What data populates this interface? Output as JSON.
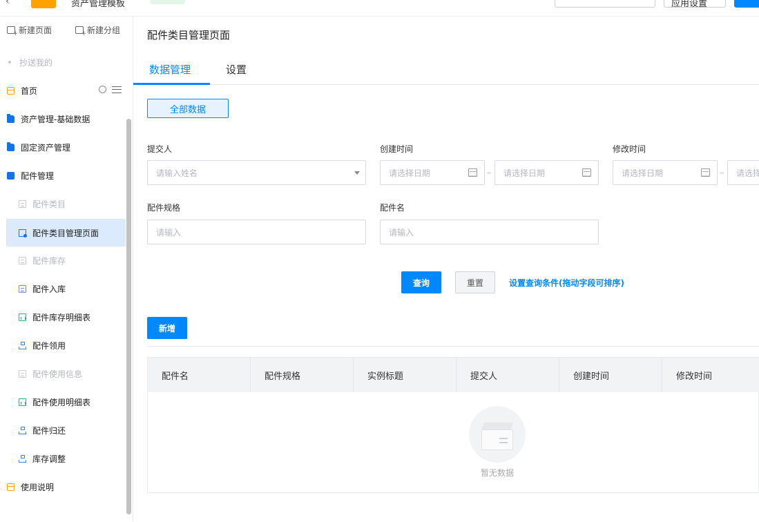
{
  "topbar": {
    "back_icon": "chevron-left-icon",
    "app_name": "资产管理模板",
    "mid_text": "",
    "button1": "",
    "button2": "应用设置",
    "button3": "",
    "accent": "#0089ff"
  },
  "sidebar": {
    "new_page": "新建页面",
    "new_group": "新建分组",
    "cc_me": "抄送我的",
    "home": "首页",
    "items": [
      {
        "label": "资产管理-基础数据",
        "icon": "folder-icon"
      },
      {
        "label": "固定资产管理",
        "icon": "folder-icon"
      },
      {
        "label": "配件管理",
        "icon": "folder-open-icon"
      }
    ],
    "children": [
      {
        "label": "配件类目",
        "icon": "form-icon",
        "state": "dim"
      },
      {
        "label": "配件类目管理页面",
        "icon": "admin-page-icon",
        "state": "active"
      },
      {
        "label": "配件库存",
        "icon": "form-icon",
        "state": "dim"
      },
      {
        "label": "配件入库",
        "icon": "form-icon",
        "state": "normal"
      },
      {
        "label": "配件库存明细表",
        "icon": "report-icon",
        "state": "normal"
      },
      {
        "label": "配件领用",
        "icon": "flow-icon",
        "state": "normal"
      },
      {
        "label": "配件使用信息",
        "icon": "form-icon",
        "state": "dim"
      },
      {
        "label": "配件使用明细表",
        "icon": "report-icon",
        "state": "normal"
      },
      {
        "label": "配件归还",
        "icon": "flow-icon",
        "state": "normal"
      },
      {
        "label": "库存调整",
        "icon": "flow-icon",
        "state": "normal"
      }
    ],
    "usage": "使用说明"
  },
  "main": {
    "title": "配件类目管理页面",
    "tabs": [
      "数据管理",
      "设置"
    ],
    "all_data": "全部数据",
    "filters": {
      "submitter": {
        "label": "提交人",
        "placeholder": "请输入姓名"
      },
      "created": {
        "label": "创建时间",
        "start": "请选择日期",
        "end": "请选择日期"
      },
      "modified": {
        "label": "修改时间",
        "start": "请选择日期",
        "end": "请选择"
      },
      "spec": {
        "label": "配件规格",
        "placeholder": "请输入"
      },
      "name": {
        "label": "配件名",
        "placeholder": "请输入"
      }
    },
    "query": "查询",
    "reset": "重置",
    "set_query": "设置查询条件(拖动字段可排序)",
    "add": "新增",
    "columns": [
      "配件名",
      "配件规格",
      "实例标题",
      "提交人",
      "创建时间",
      "修改时间"
    ],
    "empty_text": "暂无数据"
  }
}
